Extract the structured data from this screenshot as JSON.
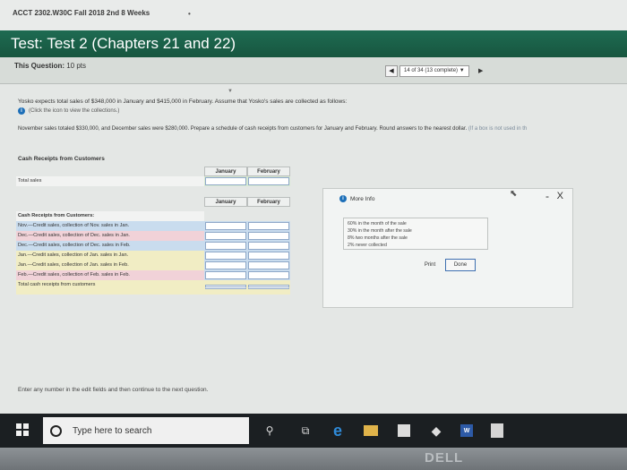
{
  "course": {
    "title": "ACCT 2302.W30C Fall 2018 2nd 8 Weeks",
    "bullet": "•"
  },
  "test": {
    "label": "Test:",
    "name": "Test 2 (Chapters 21 and 22)"
  },
  "question": {
    "label": "This Question:",
    "points": "10 pts",
    "progress": "14 of 34 (13 complete)",
    "prev_glyph": "◀",
    "dropdown_glyph": "▼",
    "next_glyph": "▶"
  },
  "prompt": {
    "chevron": "▼",
    "line1": "Yosko expects total sales of $348,000 in January and $415,000 in February. Assume that Yosko's sales are collected as follows:",
    "line2": "(Click the icon to view the collections.)",
    "line3": "November sales totaled $330,000, and December sales were $280,000. Prepare a schedule of cash receipts from customers for January and February. Round answers to the nearest dollar.",
    "line3_hint": "(If a box is not used in th"
  },
  "schedule": {
    "title": "Cash Receipts from Customers",
    "col_january": "January",
    "col_february": "February",
    "total_sales_label": "Total sales",
    "section_label": "Cash Receipts from Customers:",
    "rows": [
      {
        "label": "Nov.—Credit sales, collection of Nov. sales in Jan."
      },
      {
        "label": "Dec.—Credit sales, collection of Dec. sales in Jan."
      },
      {
        "label": "Dec.—Credit sales, collection of Dec. sales in Feb."
      },
      {
        "label": "Jan.—Credit sales, collection of Jan. sales in Jan."
      },
      {
        "label": "Jan.—Credit sales, collection of Jan. sales in Feb."
      },
      {
        "label": "Feb.—Credit sales, collection of Feb. sales in Feb."
      }
    ],
    "total_label": "Total cash receipts from customers"
  },
  "modal": {
    "title": "More Info",
    "minimize": "-",
    "close": "X",
    "rates": [
      "60% in the month of the sale",
      "30% in the month after the sale",
      "8% two months after the sale",
      "2% never collected"
    ],
    "print_label": "Print",
    "done_label": "Done"
  },
  "footer": {
    "instruction": "Enter any number in the edit fields and then continue to the next question."
  },
  "taskbar": {
    "search_placeholder": "Type here to search",
    "word_badge": "W"
  },
  "bezel": {
    "brand": "DELL"
  },
  "colors": {
    "header_green": "#1e6b52",
    "info_blue": "#1d6fb8",
    "taskbar": "#1b1f22"
  }
}
